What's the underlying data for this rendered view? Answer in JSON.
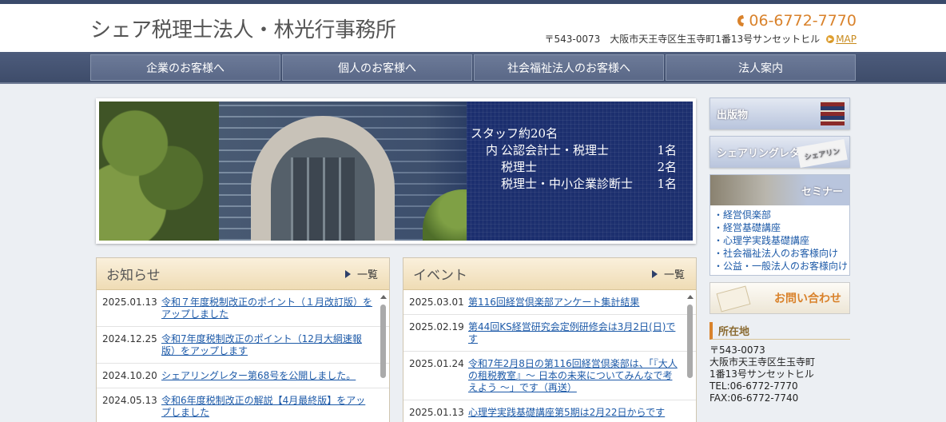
{
  "header": {
    "logo": "シェア税理士法人・林光行事務所",
    "phone": "06-6772-7770",
    "address": "〒543-0073　大阪市天王寺区生玉寺町1番13号サンセットヒル",
    "map_label": "MAP"
  },
  "nav": {
    "items": [
      {
        "label": "企業のお客様へ"
      },
      {
        "label": "個人のお客様へ"
      },
      {
        "label": "社会福祉法人のお客様へ"
      },
      {
        "label": "法人案内"
      }
    ]
  },
  "hero": {
    "heading": "スタッフ約20名",
    "rows": [
      {
        "pre": "内",
        "label": "公認会計士・税理士",
        "count": "1名"
      },
      {
        "pre": "",
        "label": "税理士",
        "count": "2名"
      },
      {
        "pre": "",
        "label": "税理士・中小企業診断士",
        "count": "1名"
      }
    ]
  },
  "news": {
    "title": "お知らせ",
    "more": "一覧",
    "items": [
      {
        "date": "2025.01.13",
        "text": "令和７年度税制改正のポイント（１月改訂版）をアップしました"
      },
      {
        "date": "2024.12.25",
        "text": "令和7年度税制改正のポイント（12月大綱速報版）をアップします"
      },
      {
        "date": "2024.10.20",
        "text": "シェアリングレター第68号を公開しました。"
      },
      {
        "date": "2024.05.13",
        "text": "令和6年度税制改正の解説【4月最終版】をアップしました"
      }
    ]
  },
  "events": {
    "title": "イベント",
    "more": "一覧",
    "items": [
      {
        "date": "2025.03.01",
        "text": "第116回経営倶楽部アンケート集計結果"
      },
      {
        "date": "2025.02.19",
        "text": "第44回KS経営研究会定例研修会は3月2日(日)です"
      },
      {
        "date": "2025.01.24",
        "text": "令和7年2月8日の第116回経営倶楽部は、「『大人の租税教室』～ 日本の未来についてみんなで考えよう ～」です（再送）"
      },
      {
        "date": "2025.01.13",
        "text": "心理学実践基礎講座第5期は2月22日からです"
      }
    ]
  },
  "sidebar": {
    "publications": "出版物",
    "letter": "シェアリングレター",
    "letter_img": "シェアリン",
    "seminar": "セミナー",
    "seminar_links": [
      "・経営倶楽部",
      "・経営基礎講座",
      "・心理学実践基礎講座",
      "・社会福祉法人のお客様向け",
      "・公益・一般法人のお客様向け"
    ],
    "contact": "お問い合わせ",
    "location_title": "所在地",
    "location_lines": [
      "〒543-0073",
      "大阪市天王寺区生玉寺町",
      "1番13号サンセットヒル",
      "TEL:06-6772-7770",
      "FAX:06-6772-7740"
    ]
  },
  "colors": {
    "nav": "#4d5c7c",
    "accent": "#d9822b",
    "link": "#1d5aa8"
  }
}
